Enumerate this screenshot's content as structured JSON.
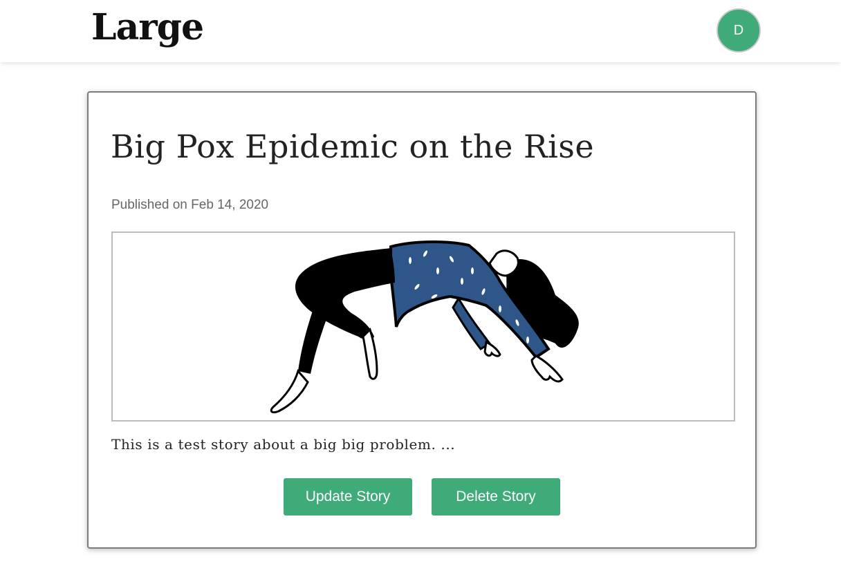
{
  "header": {
    "logo": "Large",
    "avatar_initial": "D",
    "accent_color": "#3eab79"
  },
  "story": {
    "title": "Big Pox Epidemic on the Rise",
    "published": "Published on Feb 14, 2020",
    "image_icon": "floating-woman-illustration",
    "excerpt": "This is a test story about a big big problem. ...",
    "update_label": "Update Story",
    "delete_label": "Delete Story"
  }
}
